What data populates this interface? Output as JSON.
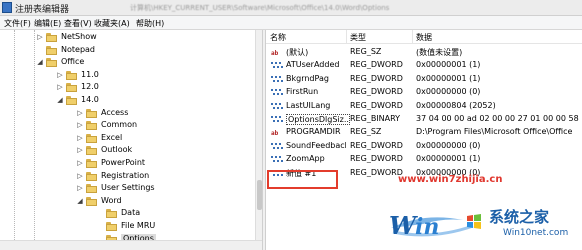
{
  "window": {
    "title": "注册表编辑器",
    "path_hint": "计算机\\HKEY_CURRENT_USER\\Software\\Microsoft\\Office\\14.0\\Word\\Options"
  },
  "menu": [
    "文件(F)",
    "编辑(E)",
    "查看(V)",
    "收藏夹(A)",
    "帮助(H)"
  ],
  "tree": [
    {
      "label": "NetShow"
    },
    {
      "label": "Notepad"
    },
    {
      "label": "Office"
    },
    {
      "label": "11.0"
    },
    {
      "label": "12.0"
    },
    {
      "label": "14.0"
    },
    {
      "label": "Access"
    },
    {
      "label": "Common"
    },
    {
      "label": "Excel"
    },
    {
      "label": "Outlook"
    },
    {
      "label": "PowerPoint"
    },
    {
      "label": "Registration"
    },
    {
      "label": "User Settings"
    },
    {
      "label": "Word"
    },
    {
      "label": "Data"
    },
    {
      "label": "File MRU"
    },
    {
      "label": "Options"
    }
  ],
  "columns": {
    "name": "名称",
    "type": "类型",
    "data": "数据"
  },
  "values": [
    {
      "name": "(默认)",
      "type": "REG_SZ",
      "data": "(数值未设置)",
      "icon": "string-value-icon"
    },
    {
      "name": "ATUserAdded",
      "type": "REG_DWORD",
      "data": "0x00000001 (1)",
      "icon": "binary-value-icon"
    },
    {
      "name": "BkgrndPag",
      "type": "REG_DWORD",
      "data": "0x00000001 (1)",
      "icon": "binary-value-icon"
    },
    {
      "name": "FirstRun",
      "type": "REG_DWORD",
      "data": "0x00000000 (0)",
      "icon": "binary-value-icon"
    },
    {
      "name": "LastUILang",
      "type": "REG_DWORD",
      "data": "0x00000804 (2052)",
      "icon": "binary-value-icon"
    },
    {
      "name": "OptionsDlgSiz...",
      "type": "REG_BINARY",
      "data": "37 04 00 00 ad 02 00 00 27 01 00 00 58",
      "icon": "binary-value-icon"
    },
    {
      "name": "PROGRAMDIR",
      "type": "REG_SZ",
      "data": "D:\\Program Files\\Microsoft Office\\Office",
      "icon": "string-value-icon"
    },
    {
      "name": "SoundFeedback",
      "type": "REG_DWORD",
      "data": "0x00000000 (0)",
      "icon": "binary-value-icon"
    },
    {
      "name": "ZoomApp",
      "type": "REG_DWORD",
      "data": "0x00000001 (1)",
      "icon": "binary-value-icon"
    },
    {
      "name": "新值 #1",
      "type": "REG_DWORD",
      "data": "0x00000000 (0)",
      "icon": "binary-value-icon"
    }
  ],
  "watermark": {
    "url": "www.win7zhijia.cn",
    "brand": "系统之家",
    "site": "Win10net.com"
  },
  "colors": {
    "highlight_border": "#e33c2c",
    "watermark_red": "#e0372e",
    "logo_blue": "#1b5fa8"
  }
}
